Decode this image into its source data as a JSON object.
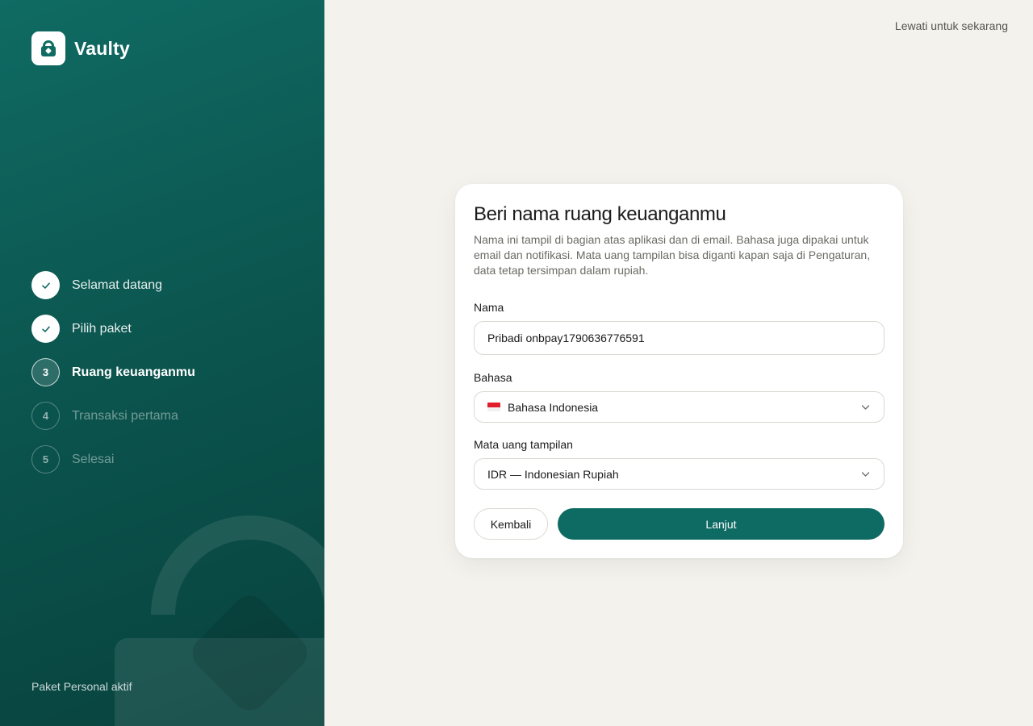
{
  "brand": {
    "name": "Vaulty",
    "logo_icon": "lock-bag-icon"
  },
  "steps": [
    {
      "label": "Selamat datang",
      "status": "done",
      "marker": ""
    },
    {
      "label": "Pilih paket",
      "status": "done",
      "marker": ""
    },
    {
      "label": "Ruang keuanganmu",
      "status": "current",
      "marker": "3"
    },
    {
      "label": "Transaksi pertama",
      "status": "todo",
      "marker": "4"
    },
    {
      "label": "Selesai",
      "status": "todo",
      "marker": "5"
    }
  ],
  "sidebar_footer": "Paket Personal aktif",
  "skip_link": "Lewati untuk sekarang",
  "card": {
    "title": "Beri nama ruang keuanganmu",
    "description": "Nama ini tampil di bagian atas aplikasi dan di email. Bahasa juga dipakai untuk email dan notifikasi. Mata uang tampilan bisa diganti kapan saja di Pengaturan, data tetap tersimpan dalam rupiah.",
    "name_label": "Nama",
    "name_value": "Pribadi onbpay1790636776591",
    "language_label": "Bahasa",
    "language_value": "Bahasa Indonesia",
    "language_flag": "indonesia-flag-icon",
    "currency_label": "Mata uang tampilan",
    "currency_value": "IDR — Indonesian Rupiah",
    "back_label": "Kembali",
    "next_label": "Lanjut"
  },
  "colors": {
    "sidebar": "#0f6b63",
    "accent": "#0e6b63",
    "background": "#f3f2ec"
  }
}
